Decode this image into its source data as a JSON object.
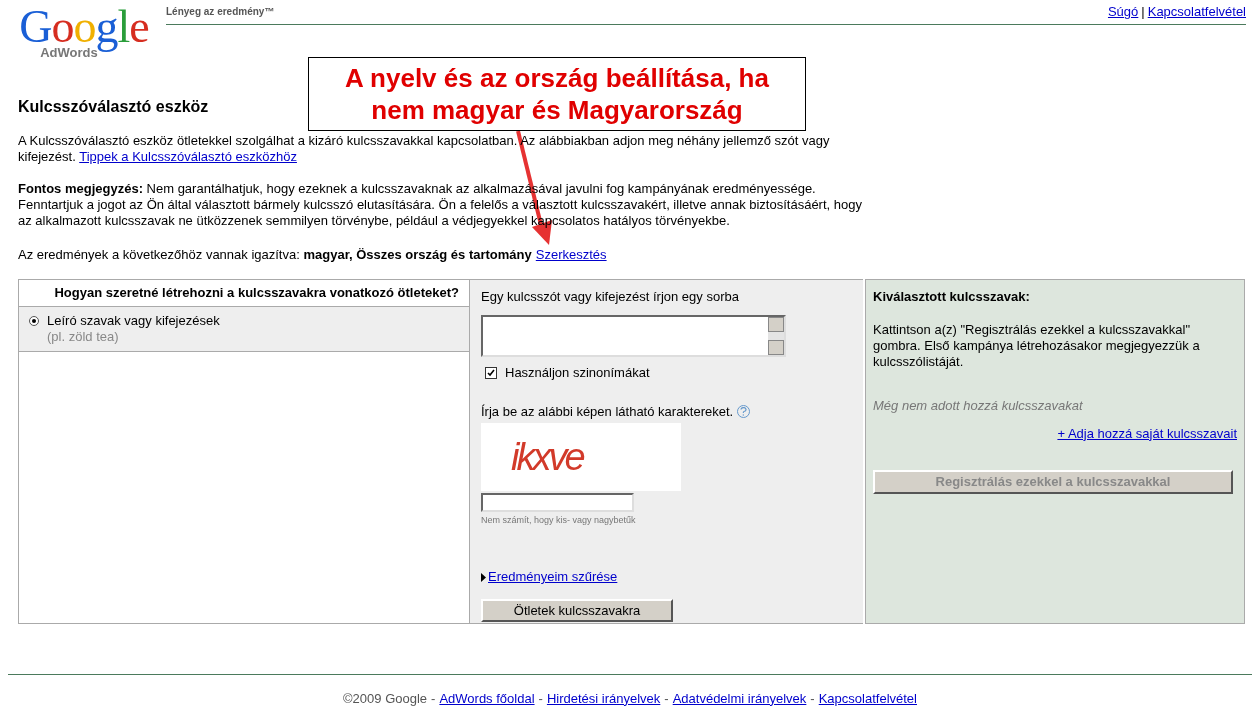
{
  "logo": {
    "wordmark": "Google",
    "product": "AdWords"
  },
  "tagline": "Lényeg az eredmény™",
  "top_links": [
    "Súgó",
    "Kapcsolatfelvétel"
  ],
  "top_links_separator": "|",
  "callout": {
    "text": "A nyelv és az ország beállítása, ha nem magyar és Magyarország"
  },
  "page_title": "Kulcsszóválasztó eszköz",
  "intro": {
    "text": "A Kulcsszóválasztó eszköz ötletekkel szolgálhat a kizáró kulcsszavakkal kapcsolatban. Az alábbiakban adjon meg néhány jellemző szót vagy kifejezést.",
    "link": "Tippek a Kulcsszóválasztó eszközhöz"
  },
  "note": "**Fontos megjegyzés:** Nem garantálhatjuk, hogy ezeknek a kulcsszavaknak az alkalmazásával javulni fog kampányának eredményessége. Fenntartjuk a jogot az Ön által választott bármely kulcsszó elutasítására. Ön a felelős a választott kulcsszavakért, illetve annak biztosításáért, hogy az alkalmazott kulcsszavak ne ütközzenek semmilyen törvénybe, például a védjegyekkel kapcsolatos hatályos törvényekbe.",
  "targeting": {
    "text": "Az eredmények a következőhöz vannak igazítva: **magyar, Összes ország és tartomány**",
    "link": "Szerkesztés"
  },
  "method_panel": {
    "heading": "Hogyan szeretné létrehozni a kulcsszavakra vonatkozó ötleteket?",
    "options": [
      {
        "label": "Leíró szavak vagy kifejezések",
        "hint": "(pl. zöld tea)",
        "selected": true
      }
    ]
  },
  "input_panel": {
    "label": "Egy kulcsszót vagy kifejezést írjon egy sorba",
    "synonyms": {
      "label": "Használjon szinonímákat",
      "checked": true
    },
    "captcha_label": "Írja be az alábbi képen látható karaktereket.",
    "captcha_text": "ikxve",
    "captcha_hint": "Nem számít, hogy kis- vagy nagybetűk",
    "filter_link": "Eredményeim szűrése",
    "submit": "Ötletek kulcsszavakra"
  },
  "selected_panel": {
    "heading": "Kiválasztott kulcsszavak:",
    "text": "Kattintson a(z) \"Regisztrálás ezekkel a kulcsszavakkal\" gombra. Első kampánya létrehozásakor megjegyezzük a kulcsszólistáját.",
    "empty": "Még nem adott hozzá kulcsszavakat",
    "add_link": "+ Adja hozzá saját kulcsszavait",
    "register": {
      "label": "Regisztrálás ezekkel a kulcsszavakkal",
      "disabled": true
    }
  },
  "footer": {
    "copyright": "©2009 Google",
    "separator": "-",
    "links": [
      "AdWords főoldal",
      "Hirdetési irányelvek",
      "Adatvédelmi irányelvek",
      "Kapcsolatfelvétel"
    ]
  }
}
